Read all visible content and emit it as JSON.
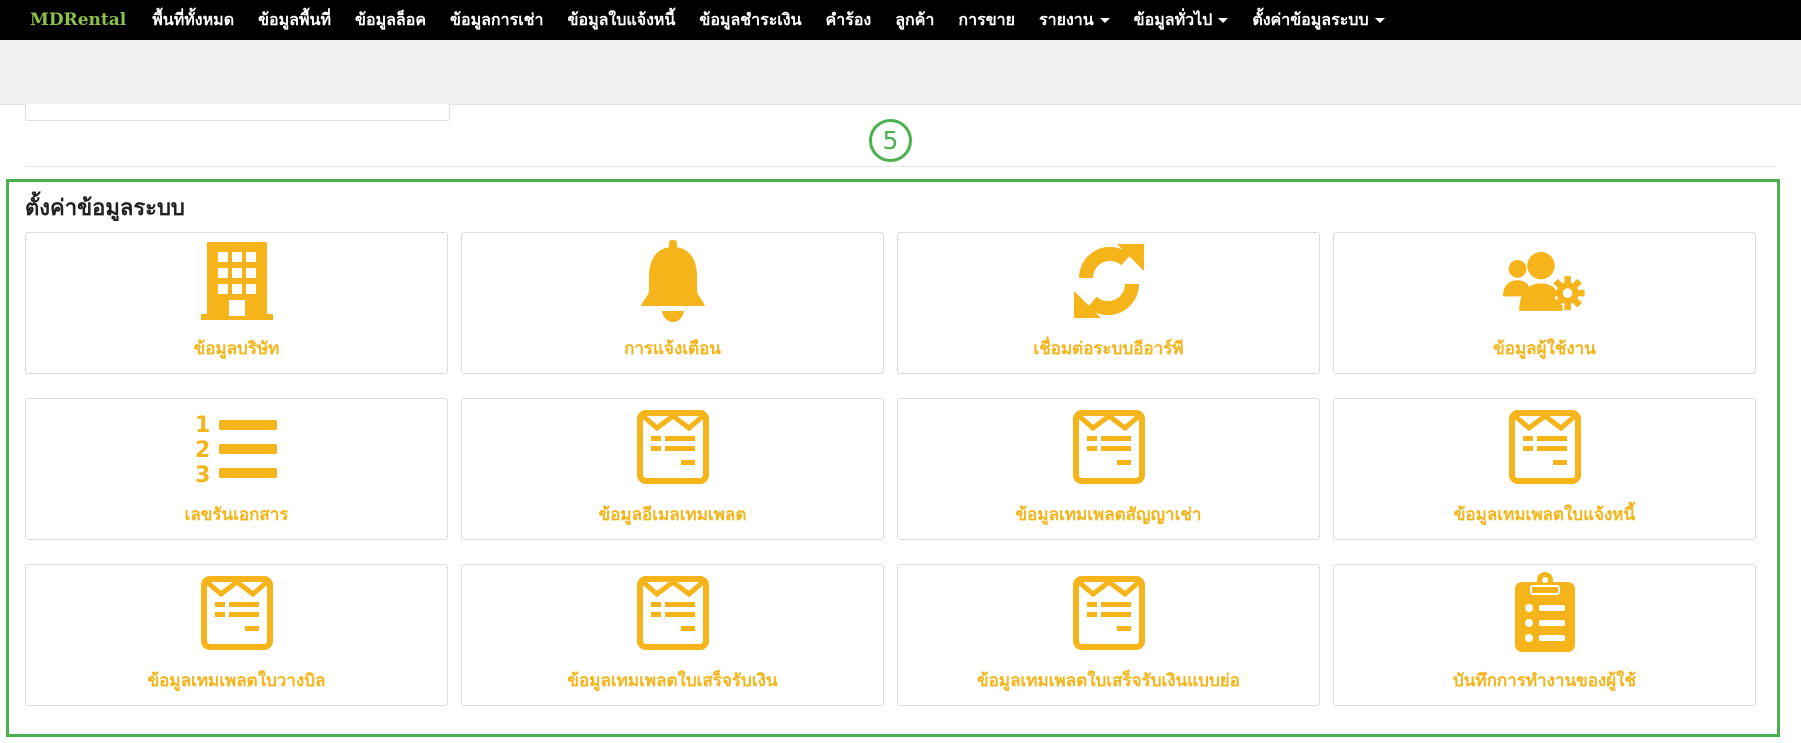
{
  "navbar": {
    "brand": "MDRental",
    "items": [
      {
        "label": "พื้นที่ทั้งหมด",
        "dropdown": false
      },
      {
        "label": "ข้อมูลพื้นที่",
        "dropdown": false
      },
      {
        "label": "ข้อมูลล็อค",
        "dropdown": false
      },
      {
        "label": "ข้อมูลการเช่า",
        "dropdown": false
      },
      {
        "label": "ข้อมูลใบแจ้งหนี้",
        "dropdown": false
      },
      {
        "label": "ข้อมูลชำระเงิน",
        "dropdown": false
      },
      {
        "label": "คำร้อง",
        "dropdown": false
      },
      {
        "label": "ลูกค้า",
        "dropdown": false
      },
      {
        "label": "การขาย",
        "dropdown": false
      },
      {
        "label": "รายงาน",
        "dropdown": true
      },
      {
        "label": "ข้อมูลทั่วไป",
        "dropdown": true
      },
      {
        "label": "ตั้งค่าข้อมูลระบบ",
        "dropdown": true
      }
    ]
  },
  "step_badge": "5",
  "section": {
    "title": "ตั้งค่าข้อมูลระบบ",
    "tiles": [
      {
        "label": "ข้อมูลบริษัท",
        "icon": "building-icon"
      },
      {
        "label": "การแจ้งเตือน",
        "icon": "bell-icon"
      },
      {
        "label": "เชื่อมต่อระบบอีอาร์พี",
        "icon": "sync-icon"
      },
      {
        "label": "ข้อมูลผู้ใช้งาน",
        "icon": "users-cog-icon"
      },
      {
        "label": "เลขรันเอกสาร",
        "icon": "numbered-list-icon"
      },
      {
        "label": "ข้อมูลอีเมลเทมเพลต",
        "icon": "email-template-icon"
      },
      {
        "label": "ข้อมูลเทมเพลตสัญญาเช่า",
        "icon": "email-template-icon"
      },
      {
        "label": "ข้อมูลเทมเพลตใบแจ้งหนี้",
        "icon": "email-template-icon"
      },
      {
        "label": "ข้อมูลเทมเพลตใบวางบิล",
        "icon": "email-template-icon"
      },
      {
        "label": "ข้อมูลเทมเพลตใบเสร็จรับเงิน",
        "icon": "email-template-icon"
      },
      {
        "label": "ข้อมูลเทมเพลตใบเสร็จรับเงินแบบย่อ",
        "icon": "email-template-icon"
      },
      {
        "label": "บันทึกการทำงานของผู้ใช้",
        "icon": "clipboard-list-icon"
      }
    ]
  },
  "colors": {
    "accent": "#f4b41a",
    "highlight": "#4caf50",
    "brand": "#8bc34a",
    "navbar_bg": "#000000"
  }
}
